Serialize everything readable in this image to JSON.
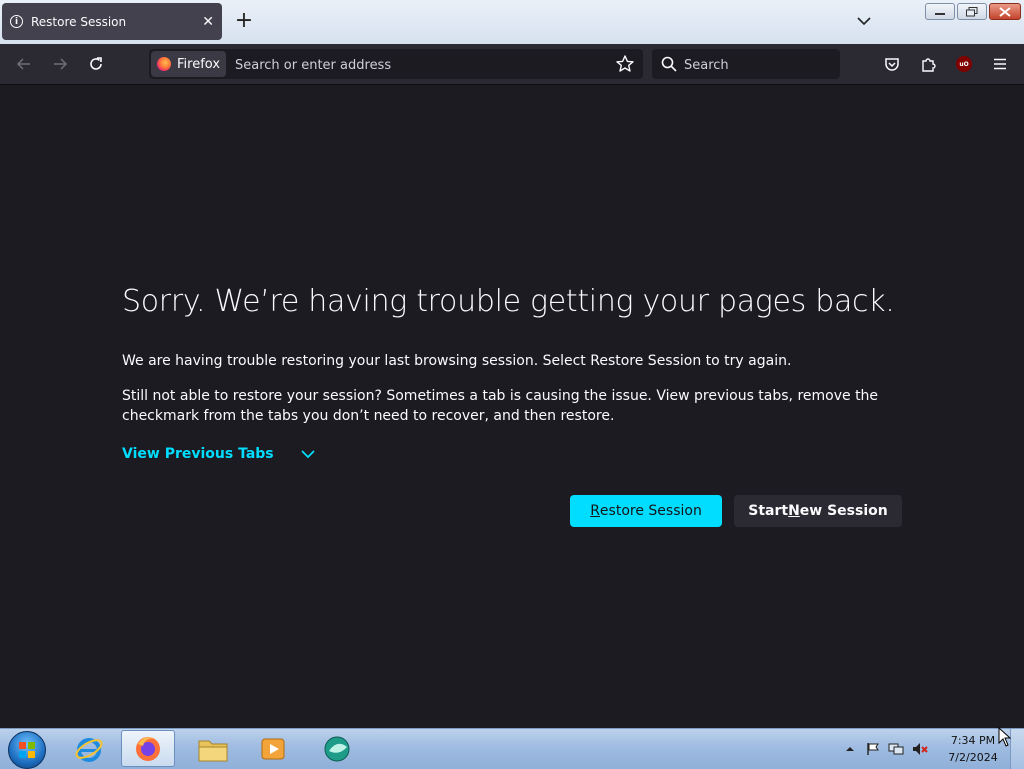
{
  "window": {
    "tab": {
      "title": "Restore Session"
    }
  },
  "toolbar": {
    "identity_label": "Firefox",
    "url_placeholder": "Search or enter address",
    "search_placeholder": "Search",
    "ublock_badge": "uO"
  },
  "page": {
    "heading": "Sorry. We’re having trouble getting your pages back.",
    "para1": "We are having trouble restoring your last browsing session. Select Restore Session to try again.",
    "para2": "Still not able to restore your session? Sometimes a tab is causing the issue. View previous tabs, remove the checkmark from the tabs you don’t need to recover, and then restore.",
    "view_previous_tabs": "View Previous Tabs",
    "restore_button": {
      "first": "R",
      "rest": "estore Session"
    },
    "new_session_button": {
      "before": "Start ",
      "accel": "N",
      "after": "ew Session"
    },
    "accent_color": "#00ddff"
  },
  "taskbar": {
    "time": "7:34 PM",
    "date": "7/2/2024",
    "items": [
      "start-orb",
      "internet-explorer-icon",
      "firefox-icon",
      "file-explorer-icon",
      "media-player-icon",
      "app-icon"
    ]
  }
}
